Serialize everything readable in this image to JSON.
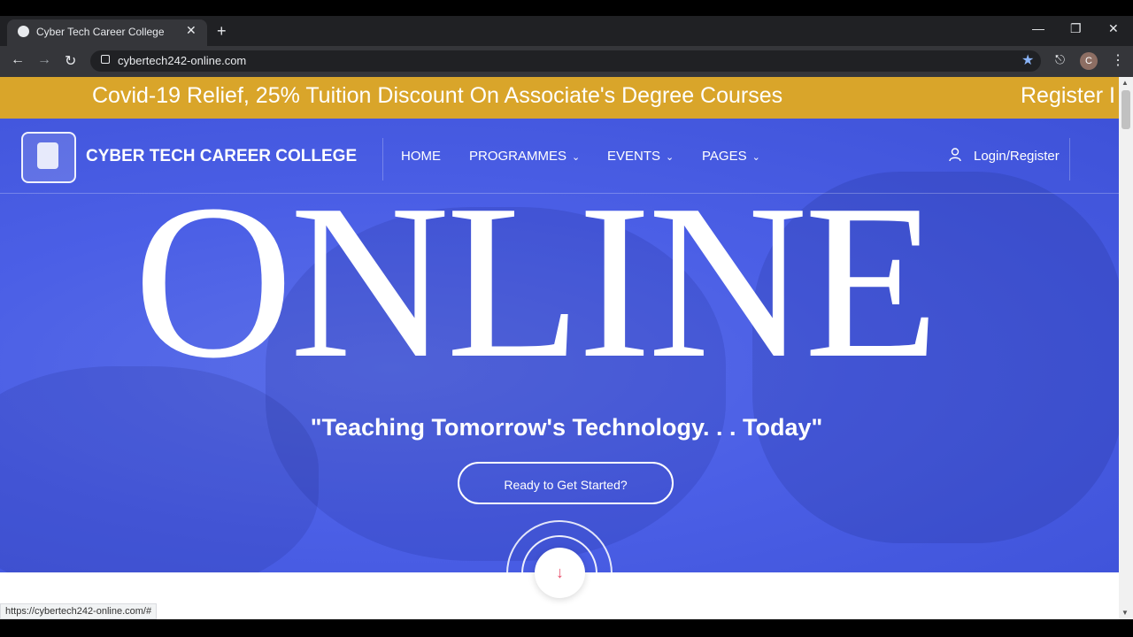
{
  "browser": {
    "tab_title": "Cyber Tech Career College",
    "tab_close": "✕",
    "new_tab": "+",
    "url": "cybertech242-online.com",
    "status_url": "https://cybertech242-online.com/#",
    "profile_initial": "C",
    "icons": {
      "back": "back-arrow-icon",
      "forward": "forward-arrow-icon",
      "reload": "reload-icon",
      "star": "bookmark-star-icon",
      "extensions": "puzzle-icon",
      "menu": "kebab-menu-icon"
    }
  },
  "banner": {
    "text": "Covid-19 Relief, 25% Tuition Discount On Associate's Degree Courses",
    "text_next": "Register I",
    "color": "#d9a52a"
  },
  "nav": {
    "brand": "CYBER TECH CAREER COLLEGE",
    "items": [
      {
        "label": "HOME"
      },
      {
        "label": "PROGRAMMES"
      },
      {
        "label": "EVENTS"
      },
      {
        "label": "PAGES"
      }
    ],
    "login": "Login/Register"
  },
  "hero": {
    "headline": "ONLINE",
    "tagline": "\"Teaching Tomorrow's Technology. . . Today\"",
    "cta": "Ready to Get Started?",
    "scroll_icon": "↓",
    "bg_color": "#4b5fe6"
  }
}
